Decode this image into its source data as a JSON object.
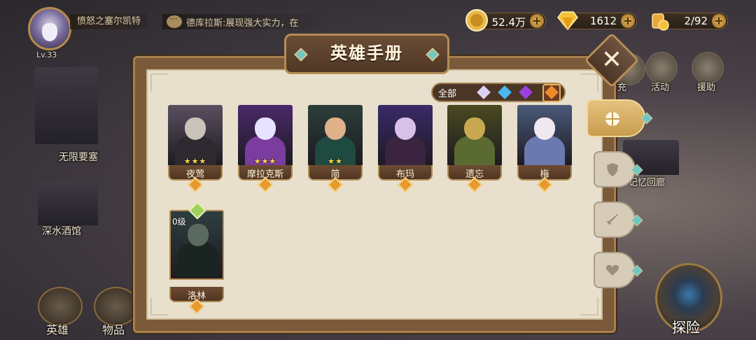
{
  "player": {
    "name": "愤怒之塞尔凯特",
    "level": "Lv.33"
  },
  "chat": {
    "message": "德库拉斯:展现强大实力，在"
  },
  "resources": [
    {
      "icon": "gold-coin-icon",
      "value": "52.4万"
    },
    {
      "icon": "diamond-icon",
      "value": "1612"
    },
    {
      "icon": "stamina-icon",
      "value": "2/92"
    }
  ],
  "map_labels": {
    "fortress": "无限要塞",
    "tavern": "深水酒馆"
  },
  "side_menu": {
    "item1": "充",
    "item2": "活动",
    "item3": "援助",
    "memory": "记忆回廊"
  },
  "bottom_nav": {
    "heroes": "英雄",
    "items": "物品",
    "explore": "探险"
  },
  "panel": {
    "title": "英雄手册",
    "filter": {
      "all": "全部",
      "colors": [
        "#d9d2f2",
        "#49b8f0",
        "#9b3fe0",
        "#f08a2a"
      ]
    }
  },
  "heroes": [
    {
      "name": "夜莺",
      "stars": "★★★",
      "palette": [
        "#5a5060",
        "#c9c2b8",
        "#2c2a30"
      ]
    },
    {
      "name": "摩拉克斯",
      "stars": "★★★",
      "palette": [
        "#4a2a6a",
        "#e6e2ff",
        "#7a3c9e"
      ]
    },
    {
      "name": "简",
      "stars": "★★",
      "palette": [
        "#2c3e3a",
        "#e0b08a",
        "#1e4a40"
      ]
    },
    {
      "name": "布玛",
      "stars": "",
      "palette": [
        "#3a2a6a",
        "#d8c0e8",
        "#3a2440"
      ]
    },
    {
      "name": "遗忘",
      "stars": "",
      "palette": [
        "#4a4a20",
        "#c8a850",
        "#5a6a30"
      ]
    },
    {
      "name": "梅",
      "stars": "",
      "palette": [
        "#4a5a7a",
        "#f0e8f0",
        "#6a7ab0"
      ]
    },
    {
      "name": "洛林",
      "stars": "",
      "level": "0级",
      "palette": [
        "#2e3e40",
        "#5a6a60",
        "#1a2420"
      ]
    }
  ]
}
